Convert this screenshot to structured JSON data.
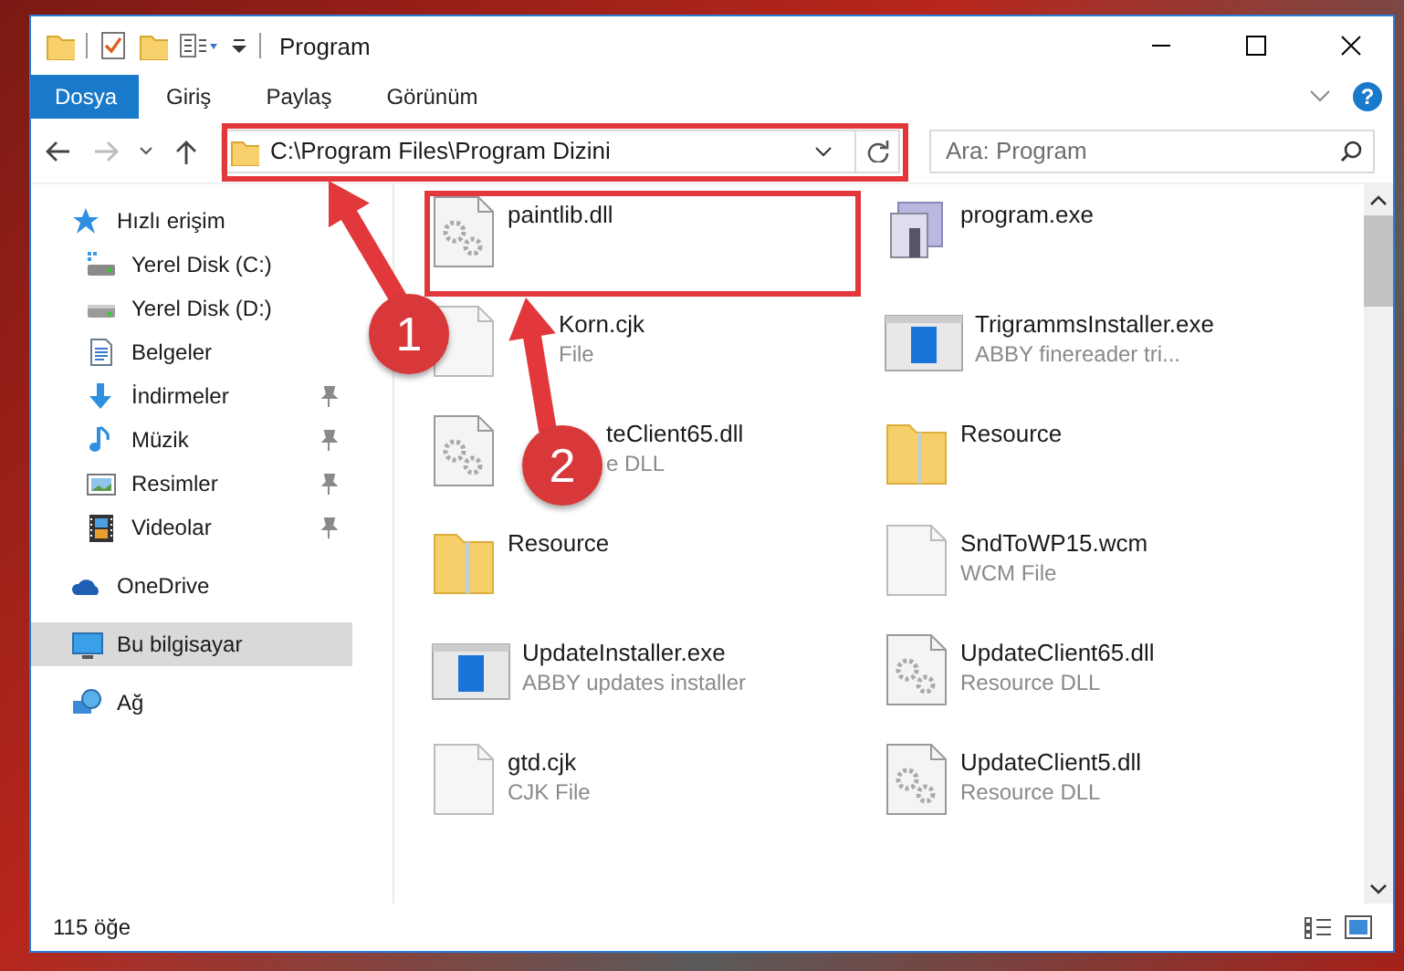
{
  "window": {
    "title": "Program"
  },
  "ribbon_tabs": [
    {
      "label": "Dosya",
      "selected": true
    },
    {
      "label": "Giriş",
      "selected": false
    },
    {
      "label": "Paylaş",
      "selected": false
    },
    {
      "label": "Görünüm",
      "selected": false
    }
  ],
  "address_bar": {
    "path": "C:\\Program Files\\Program Dizini"
  },
  "help_button": {
    "label": "?"
  },
  "search": {
    "placeholder": "Ara: Program"
  },
  "nav_pane": [
    {
      "label": "Hızlı erişim",
      "kind": "star",
      "selected": false,
      "children": [
        {
          "label": "Yerel Disk (C:)",
          "kind": "drive-c",
          "pinned": false,
          "selected": false
        },
        {
          "label": "Yerel Disk (D:)",
          "kind": "drive",
          "pinned": false,
          "selected": false
        },
        {
          "label": "Belgeler",
          "kind": "docs",
          "pinned": false,
          "selected": false
        },
        {
          "label": "İndirmeler",
          "kind": "download",
          "pinned": true,
          "selected": false
        },
        {
          "label": "Müzik",
          "kind": "music",
          "pinned": true,
          "selected": false
        },
        {
          "label": "Resimler",
          "kind": "pictures",
          "pinned": true,
          "selected": false
        },
        {
          "label": "Videolar",
          "kind": "videos",
          "pinned": true,
          "selected": false
        }
      ]
    },
    {
      "label": "OneDrive",
      "kind": "cloud",
      "selected": false
    },
    {
      "label": "Bu bilgisayar",
      "kind": "pc",
      "selected": true
    },
    {
      "label": "Ağ",
      "kind": "network",
      "selected": false
    }
  ],
  "files": [
    {
      "name": "paintlib.dll",
      "kind": "gear"
    },
    {
      "name": "program.exe",
      "kind": "app"
    },
    {
      "name": "Korn.cjk",
      "type": "File",
      "kind": "blank"
    },
    {
      "name": "TrigrammsInstaller.exe",
      "type": "ABBY finereader tri...",
      "kind": "installer"
    },
    {
      "name": "teClient65.dll",
      "type": "e DLL",
      "kind": "gear"
    },
    {
      "name": "Resource",
      "kind": "folder"
    },
    {
      "name": "Resource",
      "kind": "folder"
    },
    {
      "name": "SndToWP15.wcm",
      "type": "WCM File",
      "kind": "blank"
    },
    {
      "name": "UpdateInstaller.exe",
      "type": "ABBY updates installer",
      "kind": "installer"
    },
    {
      "name": "UpdateClient65.dll",
      "type": "Resource DLL",
      "kind": "gear"
    },
    {
      "name": "gtd.cjk",
      "type": "CJK File",
      "kind": "blank"
    },
    {
      "name": "UpdateClient5.dll",
      "type": "Resource DLL",
      "kind": "gear"
    }
  ],
  "status_bar": {
    "count": "115 öğe"
  },
  "annotations": [
    {
      "number": "1"
    },
    {
      "number": "2"
    }
  ]
}
